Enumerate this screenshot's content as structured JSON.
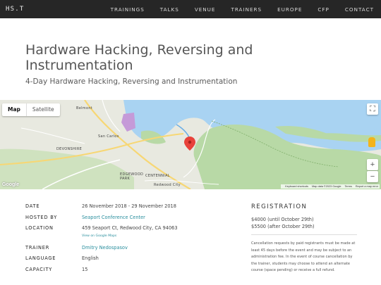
{
  "brand": "HS.T",
  "nav": [
    "TRAININGS",
    "TALKS",
    "VENUE",
    "TRAINERS",
    "EUROPE",
    "CFP",
    "CONTACT"
  ],
  "hero": {
    "title": "Hardware Hacking, Reversing and Instrumentation",
    "subtitle": "4-Day Hardware Hacking, Reversing and Instrumentation"
  },
  "map": {
    "type_map": "Map",
    "type_satellite": "Satellite",
    "zoom_in": "+",
    "zoom_out": "−",
    "fullscreen": "⛶",
    "labels": {
      "belmont": "Belmont",
      "san_carlos": "San Carlos",
      "devonshire": "DEVONSHIRE",
      "edgewood_park": "EDGEWOOD PARK",
      "centennial": "CENTENNIAL",
      "redwood_city": "Redwood City"
    },
    "logo": "Google",
    "attribution": {
      "shortcuts": "Keyboard shortcuts",
      "data": "Map data ©2023 Google",
      "terms": "Terms",
      "report": "Report a map error"
    },
    "colors": {
      "water": "#a9d3f2",
      "land": "#e8e9e0",
      "green": "#b8d9a6",
      "road": "#f7d774",
      "pin": "#e8423a"
    }
  },
  "details": {
    "date_label": "DATE",
    "date_value": "26 November 2018 - 29 November 2018",
    "hosted_label": "HOSTED BY",
    "hosted_value": "Seaport Conference Center",
    "location_label": "LOCATION",
    "location_value": "459 Seaport Ct, Redwood City, CA 94063",
    "view_maps": "View on Google Maps",
    "trainer_label": "TRAINER",
    "trainer_value": "Dmitry Nedospasov",
    "language_label": "LANGUAGE",
    "language_value": "English",
    "capacity_label": "CAPACITY",
    "capacity_value": "15"
  },
  "registration": {
    "heading": "REGISTRATION",
    "price_early": "$4000 (until October 29th)",
    "price_late": "$5500 (after October 29th)",
    "cancellation": "Cancellation requests by paid registrants must be made at least 45 days before the event and may be subject to an administration fee. In the event of course cancellation by the trainer, students may choose to attend an alternate course (space pending) or receive a full refund."
  }
}
